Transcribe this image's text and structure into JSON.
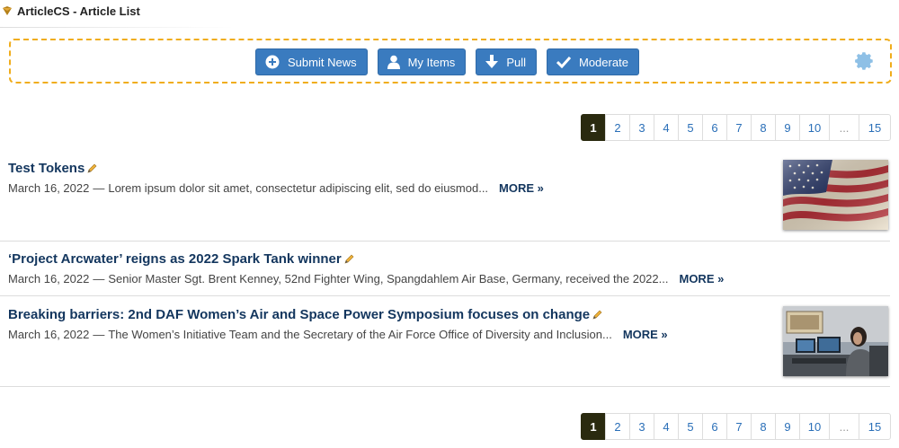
{
  "module": {
    "title": "ArticleCS - Article List"
  },
  "toolbar": {
    "buttons": [
      {
        "label": "Submit News",
        "icon": "plus-circle-icon"
      },
      {
        "label": "My Items",
        "icon": "user-icon"
      },
      {
        "label": "Pull",
        "icon": "arrow-down-icon"
      },
      {
        "label": "Moderate",
        "icon": "check-icon"
      }
    ],
    "settings_icon": "gear-icon",
    "border_color": "#f0ad1c",
    "button_color": "#3a7bbf"
  },
  "pagination": {
    "current": "1",
    "pages": [
      "1",
      "2",
      "3",
      "4",
      "5",
      "6",
      "7",
      "8",
      "9",
      "10",
      "...",
      "15"
    ]
  },
  "articles": [
    {
      "title": "Test Tokens",
      "date": "March 16, 2022",
      "separator": "—",
      "summary": "Lorem ipsum dolor sit amet, consectetur adipiscing elit, sed do eiusmod...",
      "more": "MORE »",
      "thumbnail": "american-flag"
    },
    {
      "title": "‘Project Arcwater’ reigns as 2022 Spark Tank winner",
      "date": "March 16, 2022",
      "separator": "—",
      "summary": "Senior Master Sgt. Brent Kenney, 52nd Fighter Wing, Spangdahlem Air Base, Germany, received the 2022...",
      "more": "MORE »"
    },
    {
      "title": "Breaking barriers: 2nd DAF Women’s Air and Space Power Symposium focuses on change",
      "date": "March 16, 2022",
      "separator": "—",
      "summary": "The Women’s Initiative Team and the Secretary of the Air Force Office of Diversity and Inclusion...",
      "more": "MORE »",
      "thumbnail": "woman-at-computer-desk"
    }
  ],
  "colors": {
    "title": "#13365e",
    "link": "#2a6fb8",
    "active_page": "#2a2a0f"
  }
}
